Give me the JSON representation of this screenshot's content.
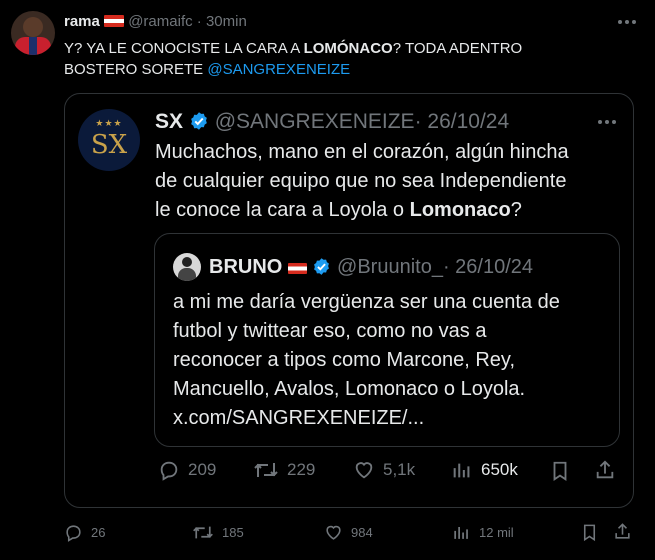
{
  "tweet": {
    "author_name": "rama",
    "handle": "@ramaifc",
    "time": "· 30min",
    "text_part1": "Y? YA LE CONOCISTE LA CARA A ",
    "text_bold": "LOMÓNACO",
    "text_part2": "? TODA ADENTRO",
    "text_line2": "BOSTERO SORETE ",
    "mention": "@SANGREXENEIZE",
    "stats": {
      "replies": "26",
      "retweets": "185",
      "likes": "984",
      "views": "12 mil"
    }
  },
  "quote": {
    "author_name": "SX",
    "logo_text": "SX",
    "handle": "@SANGREXENEIZE",
    "date": "· 26/10/24",
    "line1": "Muchachos, mano en el corazón, algún hincha",
    "line2": "de cualquier equipo que no sea Independiente",
    "line3_part1": "le conoce la cara a Loyola o ",
    "line3_bold": "Lomonaco",
    "line3_part2": "?",
    "stats": {
      "replies": "209",
      "retweets": "229",
      "likes": "5,1k",
      "views": "650k"
    }
  },
  "nested": {
    "author_name": "BRUNO",
    "handle": "@Bruunito_",
    "date": "· 26/10/24",
    "lines": [
      "a mi me daría vergüenza ser una cuenta de",
      "futbol y twittear eso, como no vas a",
      "reconocer a tipos como Marcone, Rey,",
      "Mancuello, Avalos, Lomonaco o Loyola.",
      "x.com/SANGREXENEIZE/..."
    ]
  },
  "colors": {
    "accent": "#1d9bf0",
    "muted": "#71767b",
    "border": "#2f3336",
    "gold": "#c9a24a",
    "navy": "#0b1a3a"
  },
  "icons": [
    "reply-icon",
    "retweet-icon",
    "like-icon",
    "views-icon",
    "bookmark-icon",
    "share-icon",
    "verified-icon",
    "more-icon"
  ]
}
